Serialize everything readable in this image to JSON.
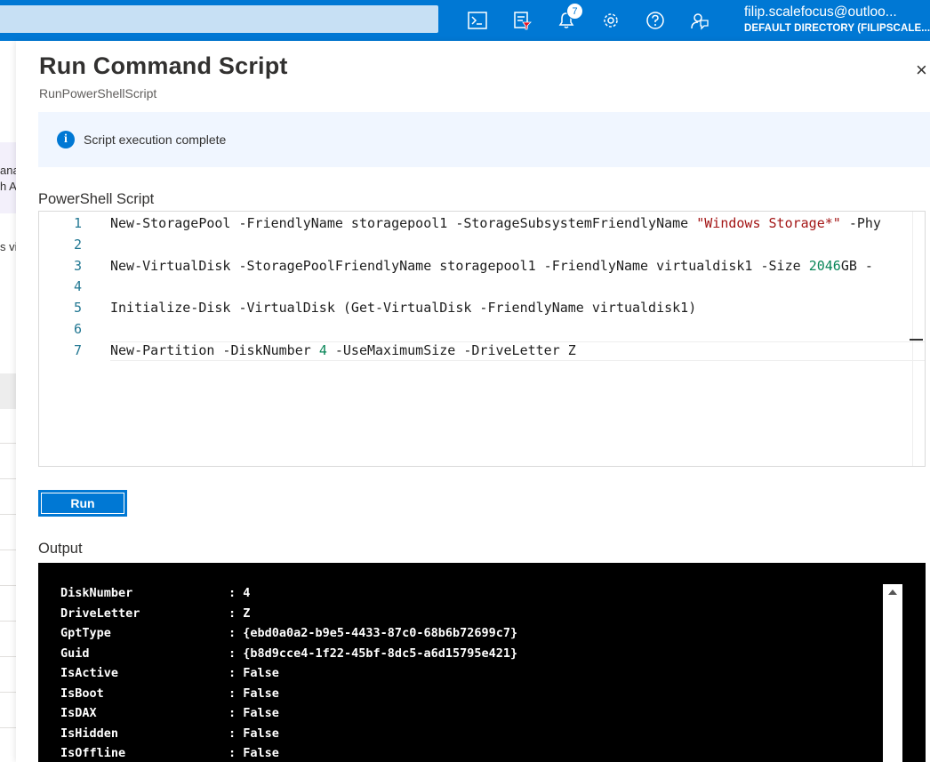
{
  "topbar": {
    "notification_count": "7",
    "account_name": "filip.scalefocus@outloo...",
    "account_directory": "DEFAULT DIRECTORY (FILIPSCALE..."
  },
  "background": {
    "fragments": [
      "ana",
      "h A",
      "s vi"
    ]
  },
  "blade": {
    "title": "Run Command Script",
    "subtitle": "RunPowerShellScript",
    "close_glyph": "×",
    "info_message": "Script execution complete",
    "script_label": "PowerShell Script",
    "run_label": "Run",
    "output_label": "Output"
  },
  "script": {
    "lines": [
      {
        "n": "1",
        "parts": [
          {
            "t": "New-StoragePool -FriendlyName storagepool1 -StorageSubsystemFriendlyName ",
            "c": ""
          },
          {
            "t": "\"Windows Storage*\"",
            "c": "str"
          },
          {
            "t": " -Phy",
            "c": ""
          }
        ]
      },
      {
        "n": "2",
        "parts": []
      },
      {
        "n": "3",
        "parts": [
          {
            "t": "New-VirtualDisk -StoragePoolFriendlyName storagepool1 -FriendlyName virtualdisk1 -Size ",
            "c": ""
          },
          {
            "t": "2046",
            "c": "num"
          },
          {
            "t": "GB -",
            "c": ""
          }
        ]
      },
      {
        "n": "4",
        "parts": []
      },
      {
        "n": "5",
        "parts": [
          {
            "t": "Initialize-Disk -VirtualDisk (Get-VirtualDisk -FriendlyName virtualdisk1)",
            "c": ""
          }
        ]
      },
      {
        "n": "6",
        "parts": []
      },
      {
        "n": "7",
        "parts": [
          {
            "t": "New-Partition -DiskNumber ",
            "c": ""
          },
          {
            "t": "4",
            "c": "num"
          },
          {
            "t": " -UseMaximumSize -DriveLetter Z",
            "c": ""
          }
        ]
      }
    ]
  },
  "output": {
    "rows": [
      {
        "key": "DiskNumber",
        "value": ": 4"
      },
      {
        "key": "DriveLetter",
        "value": ": Z"
      },
      {
        "key": "GptType",
        "value": ": {ebd0a0a2-b9e5-4433-87c0-68b6b72699c7}"
      },
      {
        "key": "Guid",
        "value": ": {b8d9cce4-1f22-45bf-8dc5-a6d15795e421}"
      },
      {
        "key": "IsActive",
        "value": ": False"
      },
      {
        "key": "IsBoot",
        "value": ": False"
      },
      {
        "key": "IsDAX",
        "value": ": False"
      },
      {
        "key": "IsHidden",
        "value": ": False"
      },
      {
        "key": "IsOffline",
        "value": ": False"
      }
    ]
  },
  "colors": {
    "azure_blue": "#0078d4",
    "info_bg": "#f0f6ff",
    "console_bg": "#000000"
  }
}
